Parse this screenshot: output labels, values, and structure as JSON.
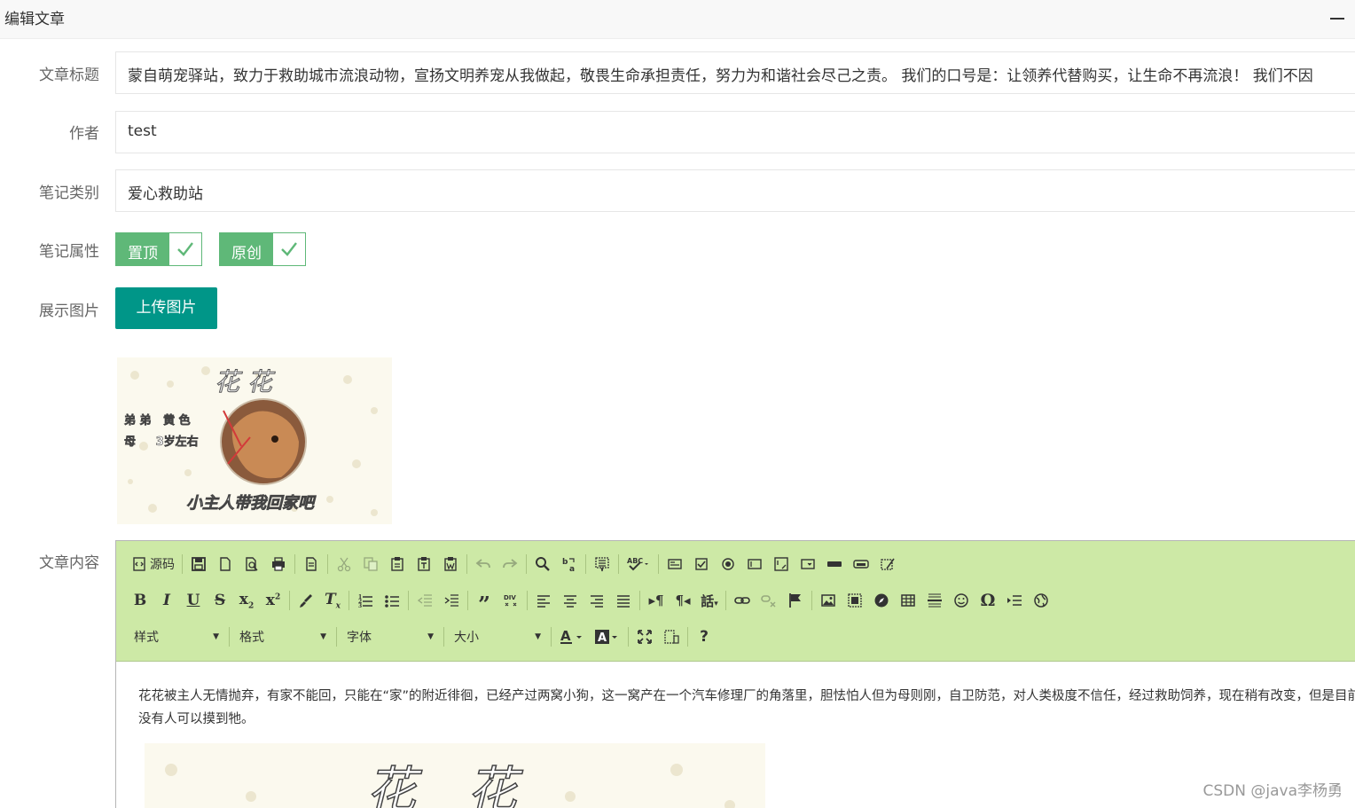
{
  "window": {
    "title": "编辑文章"
  },
  "form": {
    "title_label": "文章标题",
    "title_value": "蒙自萌宠驿站，致力于救助城市流浪动物，宣扬文明养宠从我做起，敬畏生命承担责任，努力为和谐社会尽己之责。 我们的口号是：让领养代替购买，让生命不再流浪！ 我们不因",
    "author_label": "作者",
    "author_value": "test",
    "category_label": "笔记类别",
    "category_value": "爱心救助站",
    "attr_label": "笔记属性",
    "attr_top": "置顶",
    "attr_original": "原创",
    "image_label": "展示图片",
    "upload_label": "上传图片",
    "content_label": "文章内容"
  },
  "preview_image": {
    "name_line": "花 花",
    "info_line1": "弟 弟   黄 色",
    "info_line2": "母     3岁左右",
    "bottom_line": "小主人带我回家吧"
  },
  "editor": {
    "source_label": "源码",
    "style_combo": "样式",
    "format_combo": "格式",
    "font_combo": "字体",
    "size_combo": "大小",
    "body_text": "花花被主人无情抛弃，有家不能回，只能在“家”的附近徘徊，已经产过两窝小狗，这一窝产在一个汽车修理厂的角落里，胆怯怕人但为母则刚，自卫防范，对人类极度不信任，经过救助饲养，现在稍有改变，但是目前也没有人可以摸到牠。",
    "body_img_text": "花 花"
  },
  "watermark": "CSDN @java李杨勇",
  "colors": {
    "green": "#5fb878",
    "teal": "#009688",
    "toolbar": "#cde9a6"
  }
}
